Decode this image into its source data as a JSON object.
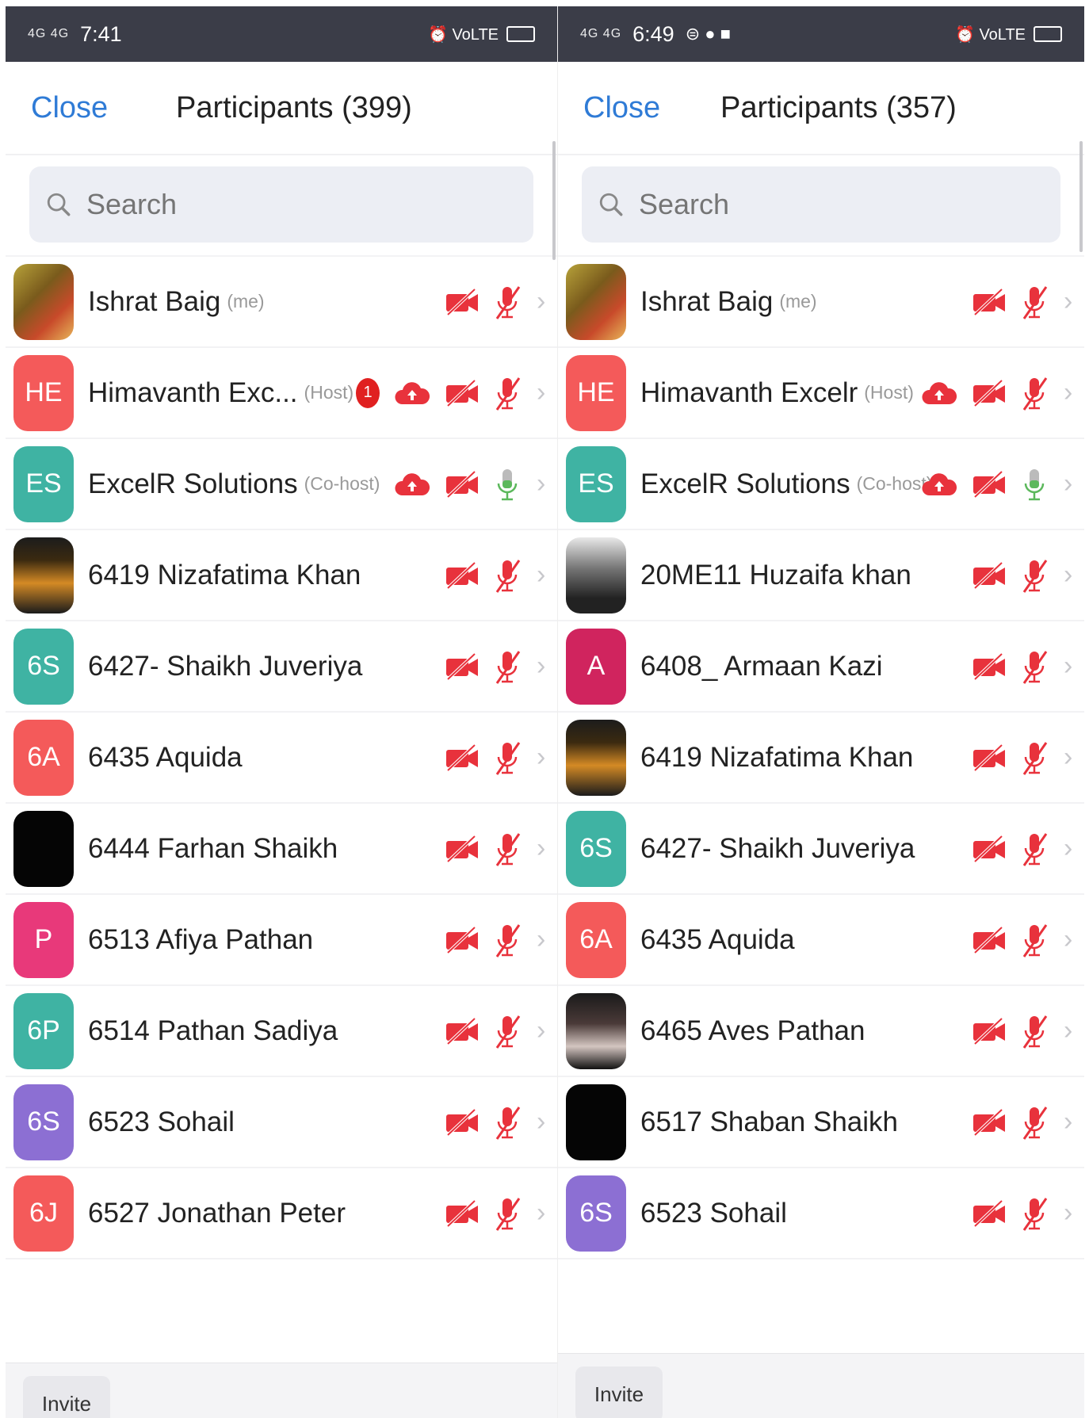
{
  "left": {
    "status": {
      "signal": "4G 4G",
      "time": "7:41",
      "extra": "",
      "right": "⏰ VoLTE"
    },
    "close_label": "Close",
    "title": "Participants (399)",
    "search_placeholder": "Search",
    "invite_label": "Invite",
    "rows": [
      {
        "avatar": "",
        "avatar_kind": "photo1",
        "name": "Ishrat Baig",
        "role": "(me)",
        "badge": "",
        "cloud": false,
        "mic": "muted"
      },
      {
        "avatar": "HE",
        "color": "#f45a5a",
        "name": "Himavanth Exc...",
        "role": "(Host)",
        "badge": "1",
        "cloud": true,
        "mic": "muted"
      },
      {
        "avatar": "ES",
        "color": "#3fb3a3",
        "name": "ExcelR Solutions",
        "role": "(Co-host)",
        "badge": "",
        "cloud": true,
        "mic": "on"
      },
      {
        "avatar": "",
        "avatar_kind": "photo2",
        "name": "6419  Nizafatima Khan",
        "role": "",
        "badge": "",
        "cloud": false,
        "mic": "muted"
      },
      {
        "avatar": "6S",
        "color": "#3fb3a3",
        "name": "6427- Shaikh Juveriya",
        "role": "",
        "badge": "",
        "cloud": false,
        "mic": "muted"
      },
      {
        "avatar": "6A",
        "color": "#f45a5a",
        "name": "6435 Aquida",
        "role": "",
        "badge": "",
        "cloud": false,
        "mic": "muted"
      },
      {
        "avatar": "",
        "avatar_kind": "black",
        "name": "6444 Farhan Shaikh",
        "role": "",
        "badge": "",
        "cloud": false,
        "mic": "muted"
      },
      {
        "avatar": "P",
        "color": "#e8397a",
        "name": "6513 Afiya Pathan",
        "role": "",
        "badge": "",
        "cloud": false,
        "mic": "muted"
      },
      {
        "avatar": "6P",
        "color": "#3fb3a3",
        "name": "6514 Pathan Sadiya",
        "role": "",
        "badge": "",
        "cloud": false,
        "mic": "muted"
      },
      {
        "avatar": "6S",
        "color": "#8c6fd3",
        "name": "6523 Sohail",
        "role": "",
        "badge": "",
        "cloud": false,
        "mic": "muted"
      },
      {
        "avatar": "6J",
        "color": "#f45a5a",
        "name": "6527 Jonathan Peter",
        "role": "",
        "badge": "",
        "cloud": false,
        "mic": "muted"
      }
    ]
  },
  "right": {
    "status": {
      "signal": "4G 4G",
      "time": "6:49",
      "extra": "⊜ ● ■",
      "right": "⏰ VoLTE"
    },
    "close_label": "Close",
    "title": "Participants (357)",
    "search_placeholder": "Search",
    "invite_label": "Invite",
    "rows": [
      {
        "avatar": "",
        "avatar_kind": "photo1",
        "name": "Ishrat Baig",
        "role": "(me)",
        "badge": "",
        "cloud": false,
        "mic": "muted"
      },
      {
        "avatar": "HE",
        "color": "#f45a5a",
        "name": "Himavanth Excelr",
        "role": "(Host)",
        "badge": "",
        "cloud": true,
        "mic": "muted"
      },
      {
        "avatar": "ES",
        "color": "#3fb3a3",
        "name": "ExcelR Solutions",
        "role": "(Co-host)",
        "badge": "",
        "cloud": true,
        "mic": "on"
      },
      {
        "avatar": "",
        "avatar_kind": "photo3",
        "name": "20ME11 Huzaifa khan",
        "role": "",
        "badge": "",
        "cloud": false,
        "mic": "muted"
      },
      {
        "avatar": "A",
        "color": "#d0245e",
        "name": "6408_ Armaan Kazi",
        "role": "",
        "badge": "",
        "cloud": false,
        "mic": "muted"
      },
      {
        "avatar": "",
        "avatar_kind": "photo2",
        "name": "6419  Nizafatima Khan",
        "role": "",
        "badge": "",
        "cloud": false,
        "mic": "muted"
      },
      {
        "avatar": "6S",
        "color": "#3fb3a3",
        "name": "6427- Shaikh Juveriya",
        "role": "",
        "badge": "",
        "cloud": false,
        "mic": "muted"
      },
      {
        "avatar": "6A",
        "color": "#f45a5a",
        "name": "6435 Aquida",
        "role": "",
        "badge": "",
        "cloud": false,
        "mic": "muted"
      },
      {
        "avatar": "",
        "avatar_kind": "photo4",
        "name": "6465 Aves Pathan",
        "role": "",
        "badge": "",
        "cloud": false,
        "mic": "muted"
      },
      {
        "avatar": "",
        "avatar_kind": "black",
        "name": "6517  Shaban Shaikh",
        "role": "",
        "badge": "",
        "cloud": false,
        "mic": "muted"
      },
      {
        "avatar": "6S",
        "color": "#8c6fd3",
        "name": "6523 Sohail",
        "role": "",
        "badge": "",
        "cloud": false,
        "mic": "muted"
      }
    ]
  },
  "colors": {
    "accent": "#2f7bd6",
    "muted_red": "#e8323c",
    "mic_green": "#5cb85c",
    "statusbar": "#3b3d48"
  }
}
